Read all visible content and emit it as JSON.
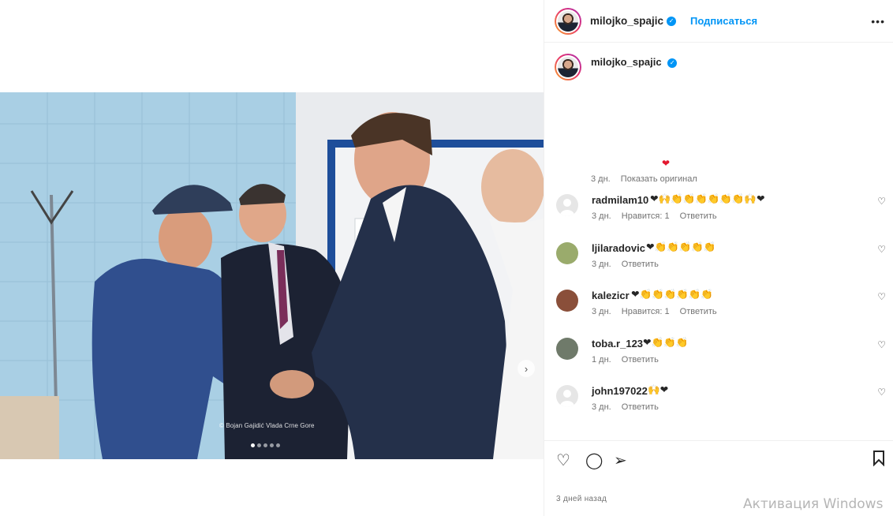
{
  "post": {
    "photo_watermark": "© Bojan Gajidić  Vlada Crne Gore",
    "carousel_dots": 5,
    "carousel_active": 0
  },
  "header": {
    "username": "milojko_spajic",
    "follow_label": "Подписаться",
    "more_label": "•••"
  },
  "caption": {
    "username": "milojko_spajic",
    "time": "3 дн.",
    "show_original_label": "Показать оригинал"
  },
  "comments": [
    {
      "username": "radmilam10",
      "text": "❤🙌👏👏👏👏👏👏🙌❤",
      "time": "3 дн.",
      "likes": "Нравится: 1",
      "reply": "Ответить"
    },
    {
      "username": "ljilaradovic",
      "text": "❤👏👏👏👏👏",
      "time": "3 дн.",
      "likes": "",
      "reply": "Ответить"
    },
    {
      "username": "kalezicr",
      "text": "❤👏👏👏👏👏👏",
      "time": "3 дн.",
      "likes": "Нравится: 1",
      "reply": "Ответить"
    },
    {
      "username": "toba.r_123",
      "text": "❤👏👏👏",
      "time": "1 дн.",
      "likes": "",
      "reply": "Ответить"
    },
    {
      "username": "john197022",
      "text": "🙌❤",
      "time": "3 дн.",
      "likes": "",
      "reply": "Ответить"
    }
  ],
  "footer": {
    "posted": "3 дней назад"
  },
  "os_overlay": {
    "activation_text": "Активация Windows"
  }
}
